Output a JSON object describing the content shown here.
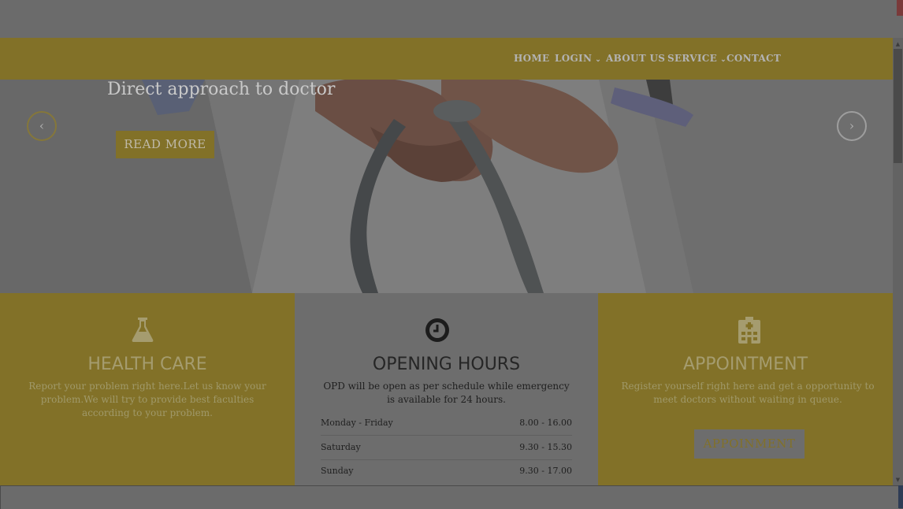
{
  "nav": {
    "items": [
      {
        "label": "HOME",
        "dropdown": false
      },
      {
        "label": "LOGIN",
        "dropdown": true
      },
      {
        "label": "ABOUT US",
        "dropdown": false
      },
      {
        "label": "SERVICE",
        "dropdown": true
      },
      {
        "label": "CONTACT",
        "dropdown": false
      }
    ],
    "caret": "⌄"
  },
  "hero": {
    "title": "Direct approach to doctor",
    "button_label": "READ MORE",
    "prev_icon": "‹",
    "next_icon": "›"
  },
  "panels": {
    "health": {
      "icon": "flask-icon",
      "title": "HEALTH CARE",
      "text": "Report your problem right here.Let us know your problem.We will try to provide best faculties according to your problem."
    },
    "hours": {
      "icon": "clock-icon",
      "title": "OPENING HOURS",
      "text": "OPD will be open as per schedule while emergency is available for 24 hours.",
      "rows": [
        {
          "day": "Monday - Friday",
          "time": "8.00 - 16.00"
        },
        {
          "day": "Saturday",
          "time": "9.30 - 15.30"
        },
        {
          "day": "Sunday",
          "time": "9.30 - 17.00"
        }
      ]
    },
    "appointment": {
      "icon": "hospital-icon",
      "title": "APPOINTMENT",
      "text": "Register yourself right here and get a opportunity to meet doctors without waiting in queue.",
      "button_label": "APPOINMENT"
    }
  },
  "scroll": {
    "up": "▲",
    "down": "▼"
  },
  "colors": {
    "brand": "#827128",
    "overlay_gray": "#6d6d6d"
  }
}
